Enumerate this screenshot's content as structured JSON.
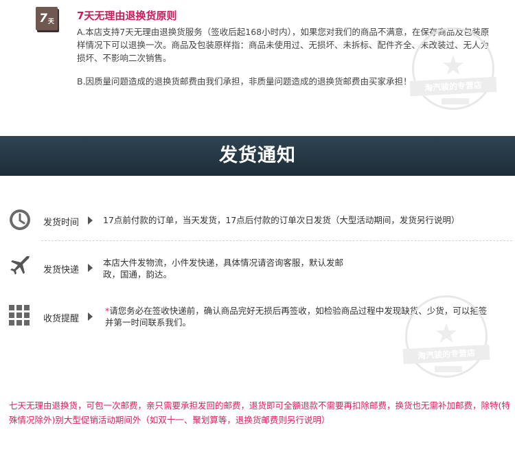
{
  "policy": {
    "badge_number": "7",
    "badge_suffix": "天",
    "title": "7天无理由退换货原则",
    "para_a": "A.本店支持7天无理由退换货服务（签收后起168小时内），如果您对我们的商品不满意，在保存商品及包装原样情况下可以退换一次。商品及包装原样指：商品未使用过、无损坏、未拆标、配件齐全、未改装过、无人为损坏、不影响二次销售。",
    "para_b": "B.因质量问题造成的退换货邮费由我们承担，非质量问题造成的退换货邮费由买家承担！",
    "watermark_text": "淘汽骏的专营店"
  },
  "header": {
    "title": "发货通知"
  },
  "rows": [
    {
      "icon": "clock-icon",
      "label": "发货时间",
      "content": "17点前付款的订单，当天发货，17点后付款的订单次日发货（大型活动期间，发货另行说明）"
    },
    {
      "icon": "airplane-icon",
      "label": "发货快递",
      "content": "本店大件发物流，小件发快递，具体情况请咨询客服，默认发邮政，国通，韵达。"
    },
    {
      "icon": "grid-icon",
      "label": "收货提醒",
      "content_star": "*",
      "content": "请您务必在签收快递前，确认商品完好无损后再签收，如检验商品过程中发现缺货、少货，可以拒签并第一时间联系我们。"
    }
  ],
  "notice": "七天无理由退换货，可包一次邮费，亲只需要承担发回的邮费，退货即可全额退款不需要再扣除邮费，换货也无需补加邮费，除特(特殊情况除外)别大型促销活动期间外（如双十一、聚划算等，退换货邮费则另行说明）",
  "colors": {
    "header_bg": "#263844",
    "accent_red": "#e01e5a",
    "title_pink": "#cc1a5a",
    "badge_bg": "#6e5850"
  }
}
